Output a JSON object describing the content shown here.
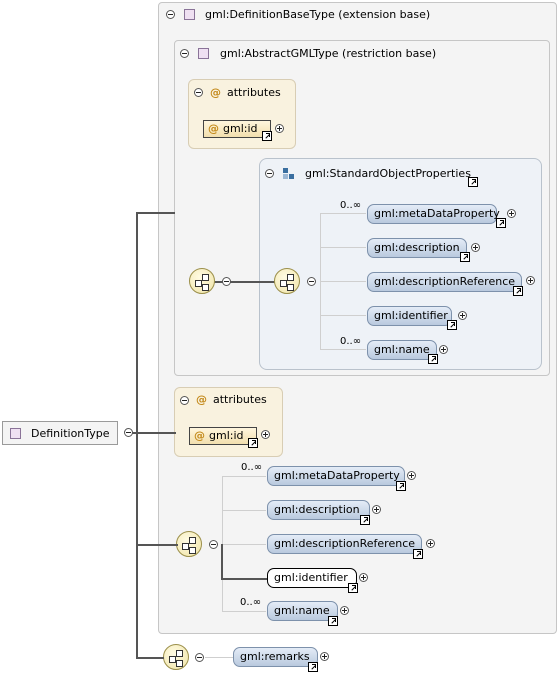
{
  "root": {
    "label": "DefinitionType"
  },
  "ext_base": {
    "label": "gml:DefinitionBaseType (extension base)"
  },
  "restr_base": {
    "label": "gml:AbstractGMLType (restriction base)"
  },
  "attributes_label": "attributes",
  "attr_id": "gml:id",
  "std_props": {
    "label": "gml:StandardObjectProperties"
  },
  "inner_elements": [
    {
      "label": "gml:metaDataProperty",
      "occ": "0..∞"
    },
    {
      "label": "gml:description",
      "occ": ""
    },
    {
      "label": "gml:descriptionReference",
      "occ": ""
    },
    {
      "label": "gml:identifier",
      "occ": ""
    },
    {
      "label": "gml:name",
      "occ": "0..∞"
    }
  ],
  "outer_elements": [
    {
      "label": "gml:metaDataProperty",
      "occ": "0..∞"
    },
    {
      "label": "gml:description",
      "occ": ""
    },
    {
      "label": "gml:descriptionReference",
      "occ": ""
    },
    {
      "label": "gml:identifier",
      "occ": ""
    },
    {
      "label": "gml:name",
      "occ": "0..∞"
    }
  ],
  "remarks": {
    "label": "gml:remarks"
  },
  "icons": {
    "collapse": "minus-circle-icon",
    "expand": "plus-circle-icon",
    "complex_type": "complex-type-icon",
    "sequence": "sequence-icon",
    "reference": "reference-arrow-icon",
    "attribute": "at-sign-icon"
  },
  "colors": {
    "element_fill": "#c9d7ea",
    "attribute_fill": "#f9f2df",
    "sequence_fill": "#efe3a6",
    "group_fill": "#eef2f7"
  }
}
